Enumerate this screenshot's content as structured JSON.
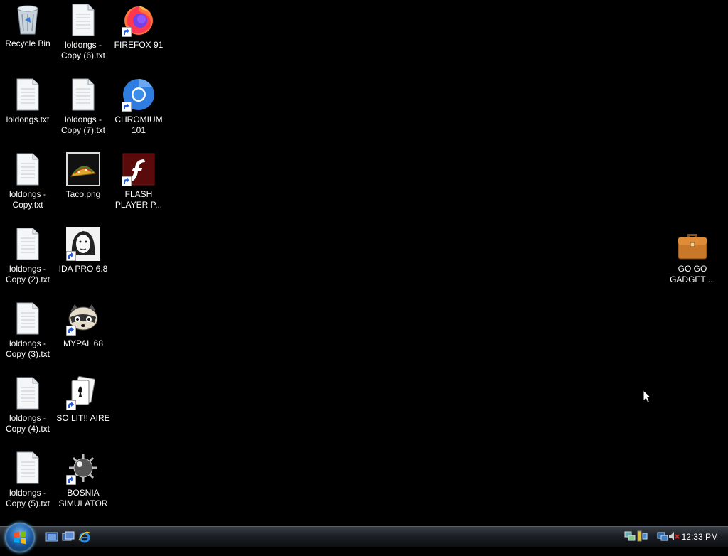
{
  "desktop": {
    "icons": {
      "recycle_bin": "Recycle Bin",
      "copy6": "loldongs -\nCopy (6).txt",
      "firefox": "FIREFOX 91",
      "loldongs": "loldongs.txt",
      "copy7": "loldongs -\nCopy (7).txt",
      "chromium": "CHROMIUM\n101",
      "copy": "loldongs -\nCopy.txt",
      "taco": "Taco.png",
      "flash": "FLASH\nPLAYER P...",
      "copy2": "loldongs -\nCopy (2).txt",
      "ida": "IDA PRO 6.8",
      "copy3": "loldongs -\nCopy (3).txt",
      "mypal": "MYPAL 68",
      "copy4": "loldongs -\nCopy (4).txt",
      "solitaire": "SO LIT!! AIRE",
      "copy5": "loldongs -\nCopy (5).txt",
      "bosnia": "BOSNIA\nSIMULATOR",
      "gadget": "GO GO\nGADGET ..."
    }
  },
  "taskbar": {
    "clock": "12:33 PM"
  }
}
